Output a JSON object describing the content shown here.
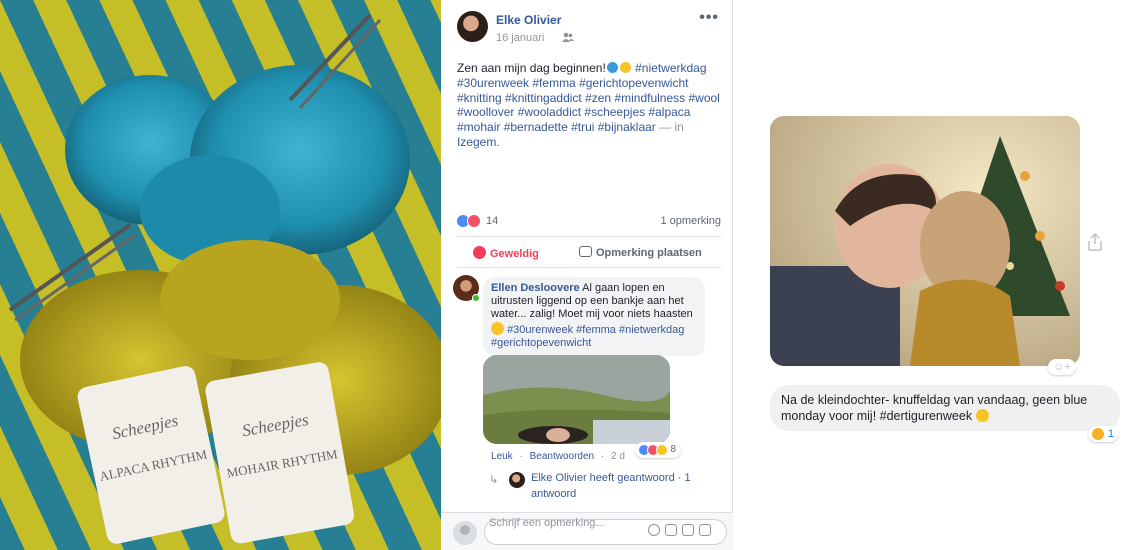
{
  "post": {
    "author": "Elke Olivier",
    "date": "16 januari",
    "more": "•••",
    "text_intro": "Zen aan mijn dag beginnen!",
    "hashtags": "#nietwerkdag #30urenweek #femma #gerichtopevenwicht #knitting #knittingaddict #zen #mindfulness #wool #woollover #wooladdict #scheepjes #alpaca #mohair #bernadette #trui #bijnaklaar",
    "location_sep": "— in",
    "location": "Izegem."
  },
  "stats": {
    "reaction_count": "14",
    "comment_count": "1 opmerking"
  },
  "actions": {
    "like": "Geweldig",
    "comment": "Opmerking plaatsen"
  },
  "comment": {
    "author": "Ellen Desloovere",
    "text": "Al gaan lopen en uitrusten liggend op een bankje aan het water... zalig! Moet mij voor niets haasten",
    "hashtags": "#30urenweek #femma #nietwerkdag #gerichtopevenwicht",
    "reaction_count": "8",
    "like": "Leuk",
    "reply": "Beantwoorden",
    "age": "2 d",
    "replies": "Elke Olivier heeft geantwoord · 1 antwoord"
  },
  "composer": {
    "placeholder": "Schrijf een opmerking..."
  },
  "message": {
    "text": "Na de kleindochter- knuffeldag van vandaag, geen blue monday voor mij! #dertigurenweek",
    "reaction_count": "1"
  },
  "colors": {
    "link": "#365899",
    "love": "#f33e58",
    "like_blue": "#4a8bf5"
  },
  "icons": [
    "audience-friends-icon",
    "more-icon",
    "heart-icon",
    "comment-icon",
    "emoji-icon",
    "camera-icon",
    "gif-icon",
    "sticker-icon",
    "share-icon",
    "add-reaction-icon"
  ]
}
